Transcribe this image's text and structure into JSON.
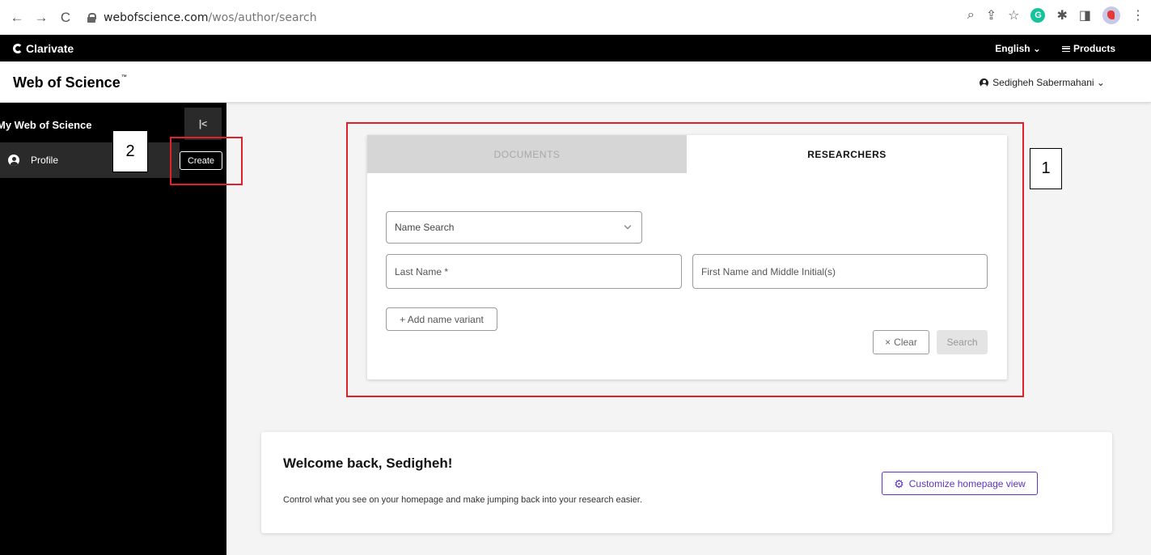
{
  "browser": {
    "url_domain": "webofscience.com",
    "url_path": "/wos/author/search",
    "back_icon": "←",
    "forward_icon": "→",
    "reload_icon": "C",
    "zoom_icon": "⌕",
    "share_icon": "⇪",
    "star_icon": "☆",
    "grammarly_label": "G",
    "puzzle_icon": "✱",
    "sidepanel_icon": "◨",
    "menu_icon": "⋮"
  },
  "topbar": {
    "brand": "Clarivate",
    "language": "English ⌄",
    "products": "Products"
  },
  "header": {
    "logo": "Web of Science",
    "logo_tm": "™",
    "user_name": "Sedigheh Sabermahani ⌄"
  },
  "sidebar": {
    "title": "My Web of Science",
    "collapse_icon": "|<",
    "profile_label": "Profile",
    "create_label": "Create"
  },
  "annotations": {
    "label_1": "1",
    "label_2": "2"
  },
  "search": {
    "tabs": [
      {
        "label": "DOCUMENTS",
        "active": false
      },
      {
        "label": "RESEARCHERS",
        "active": true
      }
    ],
    "search_type": "Name Search",
    "last_name_placeholder": "Last Name *",
    "first_name_placeholder": "First Name and Middle Initial(s)",
    "add_variant": "+ Add name variant",
    "clear_icon": "×",
    "clear_label": "Clear",
    "search_label": "Search"
  },
  "welcome": {
    "title": "Welcome back, Sedigheh!",
    "text": "Control what you see on your homepage and make jumping back into your research easier.",
    "customize_label": "Customize homepage view",
    "gear_icon": "⚙"
  },
  "colors": {
    "annotation_red": "#e0202a",
    "accent_purple": "#5e33bf"
  }
}
